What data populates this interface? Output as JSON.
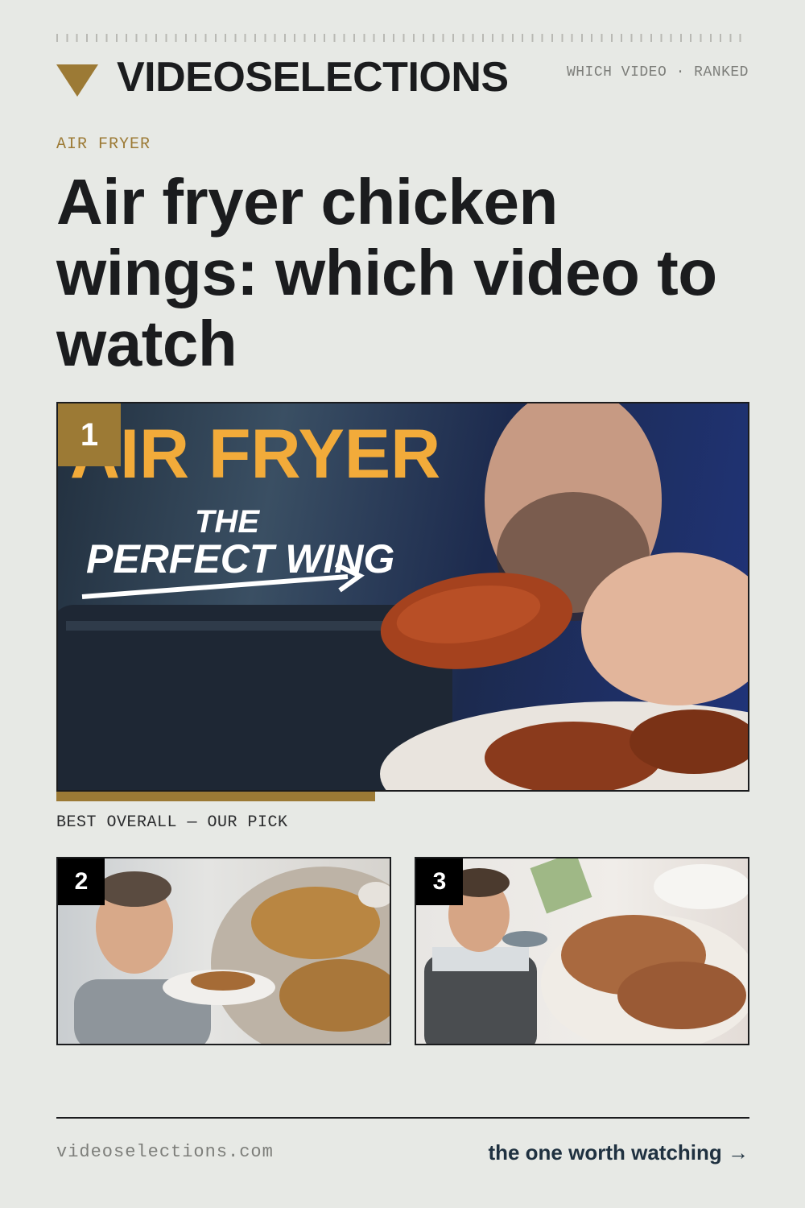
{
  "header": {
    "brand": "VIDEOSELECTIONS",
    "tagline": "WHICH VIDEO · RANKED",
    "logo_icon": "triangle-down-icon"
  },
  "article": {
    "category": "AIR FRYER",
    "title": "Air fryer chicken wings: which video to watch"
  },
  "videos": [
    {
      "rank": "1",
      "overlay_title": "AIR FRYER",
      "overlay_subtitle_1": "THE",
      "overlay_subtitle_2": "PERFECT WING",
      "caption": "BEST OVERALL — OUR PICK"
    },
    {
      "rank": "2"
    },
    {
      "rank": "3"
    }
  ],
  "footer": {
    "domain": "videoselections.com",
    "cta": "the one worth watching →"
  },
  "colors": {
    "accent": "#9c7a35",
    "background": "#e7e9e5",
    "text": "#1b1c1e",
    "cta": "#1f3140"
  }
}
